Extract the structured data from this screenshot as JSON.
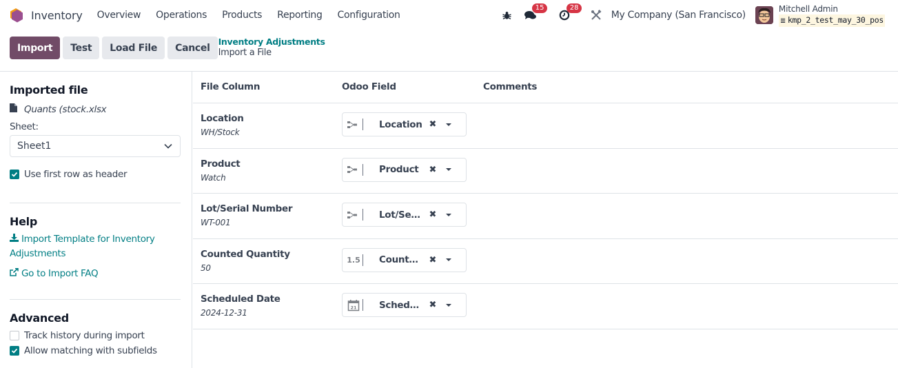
{
  "navbar": {
    "app_name": "Inventory",
    "menu": [
      "Overview",
      "Operations",
      "Products",
      "Reporting",
      "Configuration"
    ],
    "messages_count": "15",
    "activities_count": "28",
    "company": "My Company (San Francisco)",
    "user_name": "Mitchell Admin",
    "database": "kmp_2_test_may_30_pos",
    "brand_color": "#714b67",
    "badge_color": "#d63545"
  },
  "control_panel": {
    "import_label": "Import",
    "test_label": "Test",
    "load_file_label": "Load File",
    "cancel_label": "Cancel",
    "breadcrumb_parent": "Inventory Adjustments",
    "breadcrumb_current": "Import a File"
  },
  "sidebar": {
    "imported_file_title": "Imported file",
    "file_name": "Quants (stock.xlsx",
    "sheet_label": "Sheet:",
    "sheet_value": "Sheet1",
    "use_first_row_label": "Use first row as header",
    "use_first_row_checked": true,
    "help_title": "Help",
    "template_link": "Import Template for Inventory Adjustments",
    "faq_link": "Go to Import FAQ",
    "advanced_title": "Advanced",
    "track_history_label": "Track history during import",
    "track_history_checked": false,
    "allow_matching_label": "Allow matching with subfields",
    "allow_matching_checked": true,
    "accent_color": "#017e84"
  },
  "table": {
    "headers": [
      "File Column",
      "Odoo Field",
      "Comments"
    ],
    "rows": [
      {
        "column": "Location",
        "sample": "WH/Stock",
        "field": "Location",
        "field_type_icon": "many2one-icon"
      },
      {
        "column": "Product",
        "sample": "Watch",
        "field": "Product",
        "field_type_icon": "many2one-icon"
      },
      {
        "column": "Lot/Serial Number",
        "sample": "WT-001",
        "field": "Lot/Serial Number",
        "field_type_icon": "many2one-icon"
      },
      {
        "column": "Counted Quantity",
        "sample": "50",
        "field": "Counted Quantity",
        "field_type_icon": "float-icon",
        "field_type_text": "1.5"
      },
      {
        "column": "Scheduled Date",
        "sample": "2024-12-31",
        "field": "Scheduled Date",
        "field_type_icon": "calendar-icon"
      }
    ]
  }
}
